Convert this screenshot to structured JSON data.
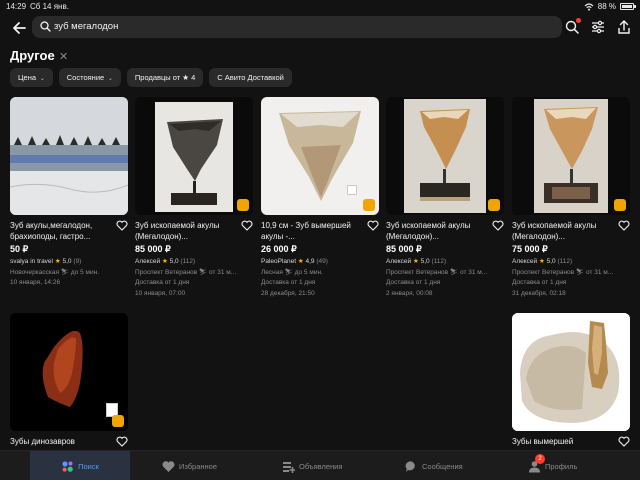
{
  "status_bar": {
    "time": "14:29",
    "date": "Сб 14 янв.",
    "battery": "88 %"
  },
  "search": {
    "query": "зуб мегалодон"
  },
  "section": {
    "title": "Другое"
  },
  "filters": [
    {
      "label": "Цена",
      "chevron": true
    },
    {
      "label": "Состояние",
      "chevron": true
    },
    {
      "label": "Продавцы от ★ 4",
      "chevron": false
    },
    {
      "label": "С Авито Доставкой",
      "chevron": false
    }
  ],
  "listings": [
    {
      "title": "Зуб акулы,мегалодон, брахиоподы, гастро...",
      "price": "50 ₽",
      "seller": "svalya in travel",
      "rating": "5,0",
      "reviews": "(9)",
      "location": "Новочеркасская ⛷ до 5 мин.",
      "date": "10 января, 14:26"
    },
    {
      "title": "Зуб ископаемой акулы (Мегалодон)...",
      "price": "85 000 ₽",
      "seller": "Алексей",
      "rating": "5,0",
      "reviews": "(112)",
      "location": "Проспект Ветеранов ⛷ от 31 м...",
      "date": "10 января, 07:00",
      "delivery": "Доставка от 1 дня"
    },
    {
      "title": "10,9 см - Зуб вымершей акулы -...",
      "price": "26 000 ₽",
      "seller": "PaleoPlanet",
      "rating": "4,9",
      "reviews": "(49)",
      "location": "Лесная ⛷ до 5 мин.",
      "date": "28 декабря, 21:50",
      "delivery": "Доставка от 1 дня"
    },
    {
      "title": "Зуб ископаемой акулы (Мегалодон)...",
      "price": "85 000 ₽",
      "seller": "Алексей",
      "rating": "5,0",
      "reviews": "(112)",
      "location": "Проспект Ветеранов ⛷ от 31 м...",
      "date": "2 января, 00:08",
      "delivery": "Доставка от 1 дня"
    },
    {
      "title": "Зуб ископаемой акулы (Мегалодон)...",
      "price": "75 000 ₽",
      "seller": "Алексей",
      "rating": "5,0",
      "reviews": "(112)",
      "location": "Проспект Ветеранов ⛷ от 31 м...",
      "date": "31 декабря, 02:18",
      "delivery": "Доставка от 1 дня"
    },
    {
      "title": "Зубы динозавров"
    },
    {
      "title": "Зубы вымершей"
    }
  ],
  "tabs": [
    {
      "label": "Поиск",
      "icon": "search-dots-icon"
    },
    {
      "label": "Избранное",
      "icon": "heart-icon"
    },
    {
      "label": "Объявления",
      "icon": "listings-icon"
    },
    {
      "label": "Сообщения",
      "icon": "chat-icon"
    },
    {
      "label": "Профиль",
      "icon": "profile-icon",
      "badge": "2"
    }
  ],
  "colors": {
    "accent": "#4d9bff",
    "star": "#ffb400",
    "badge": "#ff3b30",
    "background": "#121212"
  }
}
